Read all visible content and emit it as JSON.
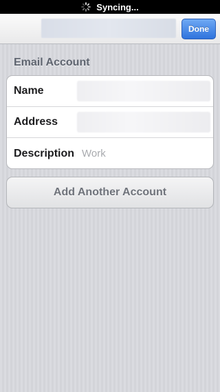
{
  "status_bar": {
    "text": "Syncing...",
    "icon": "spinner-icon"
  },
  "nav_bar": {
    "done_label": "Done"
  },
  "section": {
    "header": "Email Account"
  },
  "fields": [
    {
      "label": "Name",
      "value": ""
    },
    {
      "label": "Address",
      "value": ""
    },
    {
      "label": "Description",
      "placeholder": "Work"
    }
  ],
  "actions": {
    "add_account_label": "Add Another Account"
  },
  "colors": {
    "accent": "#2f73dd",
    "placeholder_text": "#a9abaf"
  }
}
